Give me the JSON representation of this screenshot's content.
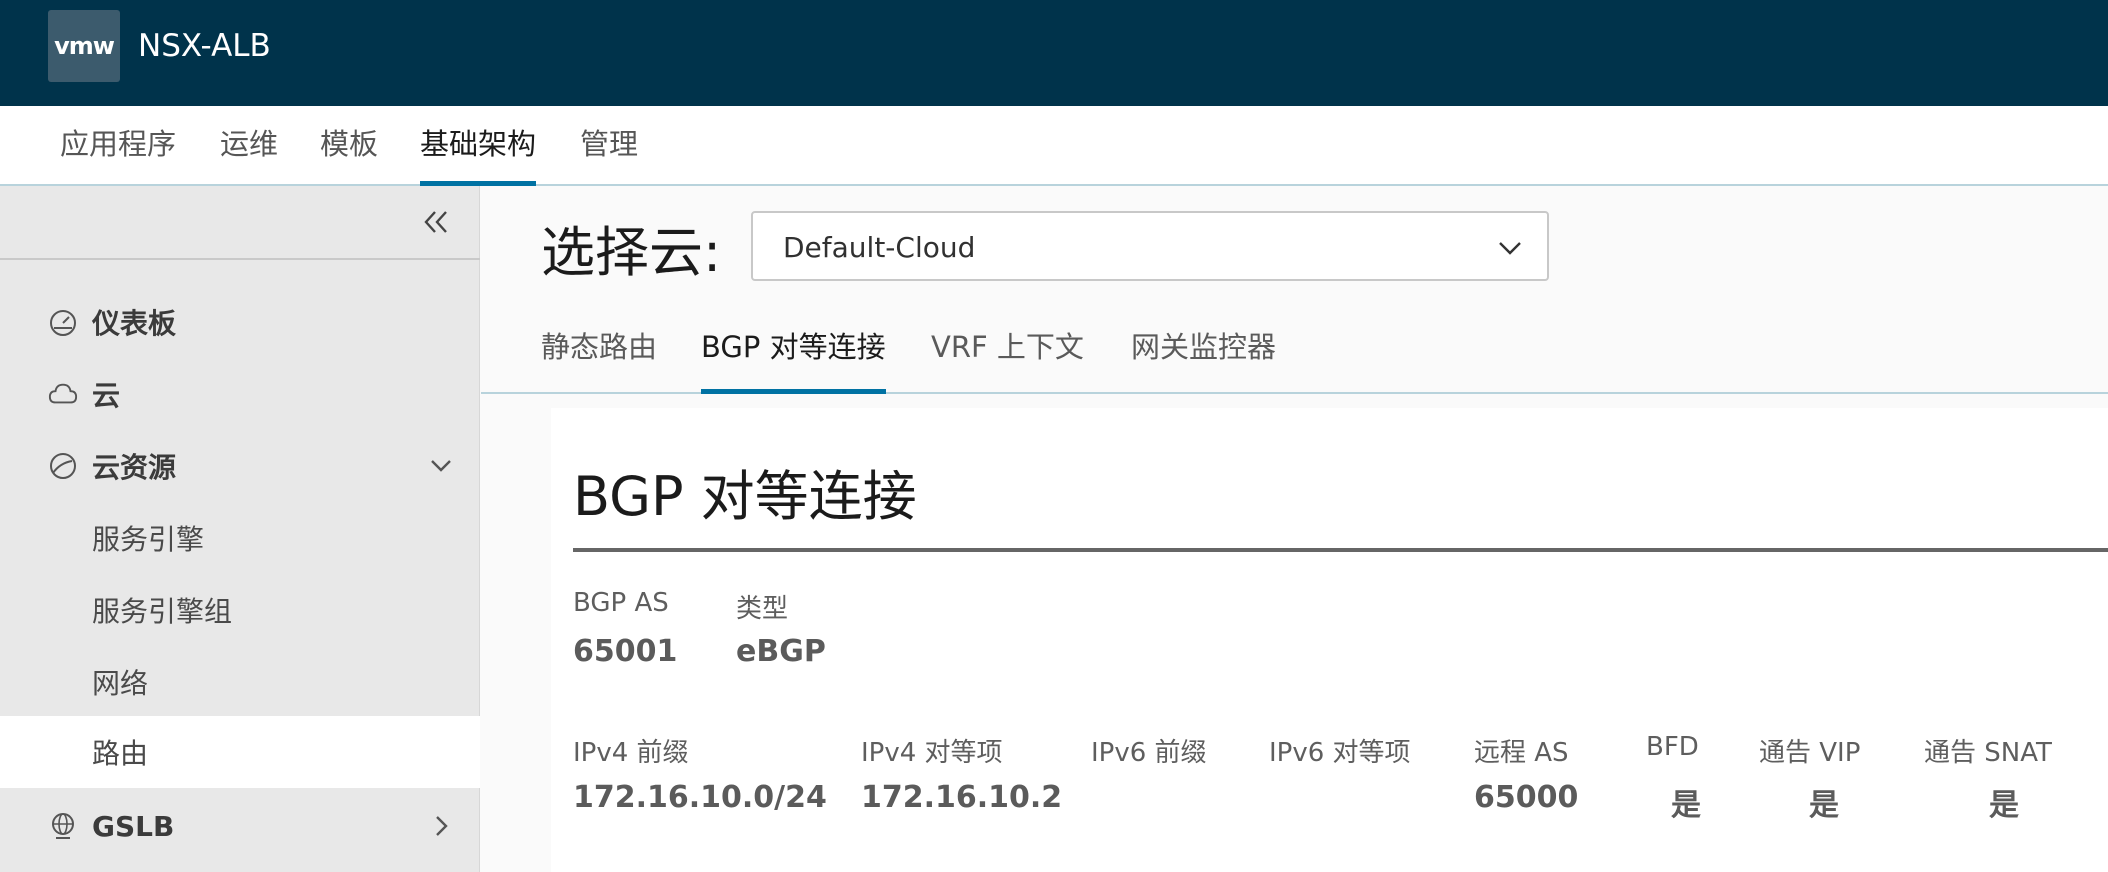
{
  "header": {
    "logo_text": "vmw",
    "app_title": "NSX-ALB"
  },
  "topnav": {
    "items": [
      "应用程序",
      "运维",
      "模板",
      "基础架构",
      "管理"
    ],
    "active": "基础架构"
  },
  "sidebar": {
    "items": [
      {
        "label": "仪表板",
        "icon": "dashboard-icon"
      },
      {
        "label": "云",
        "icon": "cloud-icon"
      },
      {
        "label": "云资源",
        "icon": "cloud-resources-icon"
      }
    ],
    "subitems": [
      "服务引擎",
      "服务引擎组",
      "网络",
      "路由"
    ],
    "active_subitem": "路由",
    "gslb": {
      "label": "GSLB",
      "icon": "gslb-icon"
    }
  },
  "cloud_selector": {
    "label": "选择云:",
    "value": "Default-Cloud"
  },
  "subtabs": {
    "items": [
      "静态路由",
      "BGP 对等连接",
      "VRF 上下文",
      "网关监控器"
    ],
    "active": "BGP 对等连接"
  },
  "card": {
    "title": "BGP 对等连接",
    "bgp_as": {
      "label": "BGP AS",
      "value": "65001"
    },
    "type": {
      "label": "类型",
      "value": "eBGP"
    },
    "peer_columns": [
      "IPv4 前缀",
      "IPv4 对等项",
      "IPv6 前缀",
      "IPv6 对等项",
      "远程 AS",
      "BFD",
      "通告 VIP",
      "通告 SNAT"
    ],
    "peer_row": [
      "172.16.10.0/24",
      "172.16.10.2",
      "",
      "",
      "65000",
      "是",
      "是",
      "是"
    ]
  },
  "colors": {
    "header_bg": "#00334b",
    "accent": "#0072a3"
  }
}
